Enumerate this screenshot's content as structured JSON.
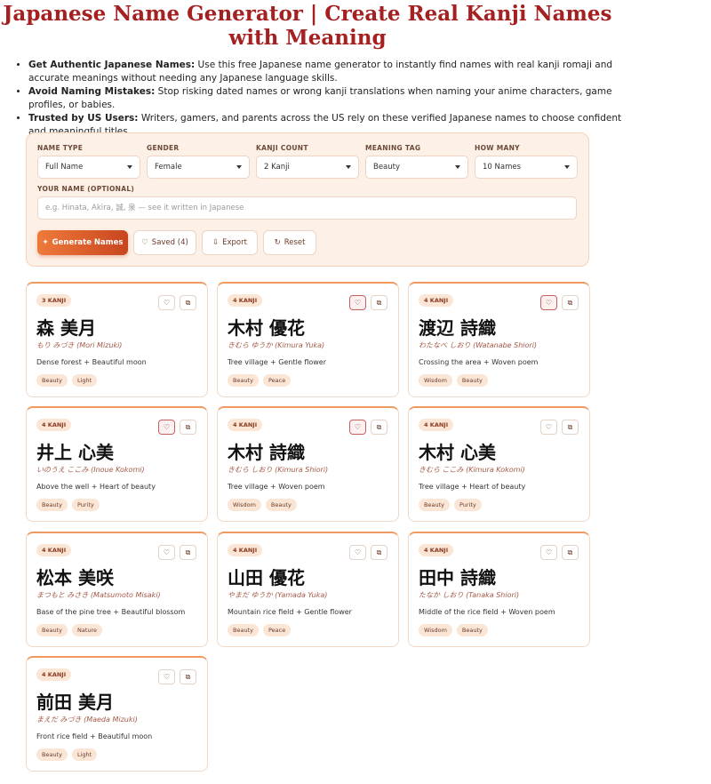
{
  "page": {
    "title": "Japanese Name Generator | Create Real Kanji Names with Meaning"
  },
  "bullets": [
    {
      "bold": "Get Authentic Japanese Names:",
      "text": " Use this free Japanese name generator to instantly find names with real kanji romaji and accurate meanings without needing any Japanese language skills."
    },
    {
      "bold": "Avoid Naming Mistakes:",
      "text": " Stop risking dated names or wrong kanji translations when naming your anime characters, game profiles, or babies."
    },
    {
      "bold": "Trusted by US Users:",
      "text": " Writers, gamers, and parents across the US rely on these verified Japanese names to choose confident and meaningful titles."
    }
  ],
  "form": {
    "name_type": {
      "label": "NAME TYPE",
      "value": "Full Name"
    },
    "gender": {
      "label": "GENDER",
      "value": "Female"
    },
    "kanji_count": {
      "label": "KANJI COUNT",
      "value": "2 Kanji"
    },
    "meaning_tag": {
      "label": "MEANING TAG",
      "value": "Beauty"
    },
    "how_many": {
      "label": "HOW MANY",
      "value": "10 Names"
    },
    "your_name": {
      "label": "YOUR NAME (OPTIONAL)",
      "placeholder": "e.g. Hinata, Akira, 誠, 泉 — see it written in Japanese"
    }
  },
  "actions": {
    "generate": "Generate Names",
    "saved": "Saved (4)",
    "export": "Export",
    "reset": "Reset"
  },
  "cards": [
    {
      "badge": "3 KANJI",
      "kanji": "森 美月",
      "reading": "もり みづき (Mori Mizuki)",
      "meaning": "Dense forest + Beautiful moon",
      "tags": [
        "Beauty",
        "Light"
      ],
      "saved": false
    },
    {
      "badge": "4 KANJI",
      "kanji": "木村 優花",
      "reading": "きむら ゆうか (Kimura Yuka)",
      "meaning": "Tree village + Gentle flower",
      "tags": [
        "Beauty",
        "Peace"
      ],
      "saved": true
    },
    {
      "badge": "4 KANJI",
      "kanji": "渡辺 詩織",
      "reading": "わたなべ しおり (Watanabe Shiori)",
      "meaning": "Crossing the area + Woven poem",
      "tags": [
        "Wisdom",
        "Beauty"
      ],
      "saved": true
    },
    {
      "badge": "4 KANJI",
      "kanji": "井上 心美",
      "reading": "いのうえ ここみ (Inoue Kokomi)",
      "meaning": "Above the well + Heart of beauty",
      "tags": [
        "Beauty",
        "Purity"
      ],
      "saved": true
    },
    {
      "badge": "4 KANJI",
      "kanji": "木村 詩織",
      "reading": "きむら しおり (Kimura Shiori)",
      "meaning": "Tree village + Woven poem",
      "tags": [
        "Wisdom",
        "Beauty"
      ],
      "saved": true
    },
    {
      "badge": "4 KANJI",
      "kanji": "木村 心美",
      "reading": "きむら ここみ (Kimura Kokomi)",
      "meaning": "Tree village + Heart of beauty",
      "tags": [
        "Beauty",
        "Purity"
      ],
      "saved": false
    },
    {
      "badge": "4 KANJI",
      "kanji": "松本 美咲",
      "reading": "まつもと みさき (Matsumoto Misaki)",
      "meaning": "Base of the pine tree + Beautiful blossom",
      "tags": [
        "Beauty",
        "Nature"
      ],
      "saved": false
    },
    {
      "badge": "4 KANJI",
      "kanji": "山田 優花",
      "reading": "やまだ ゆうか (Yamada Yuka)",
      "meaning": "Mountain rice field + Gentle flower",
      "tags": [
        "Beauty",
        "Peace"
      ],
      "saved": false
    },
    {
      "badge": "4 KANJI",
      "kanji": "田中 詩織",
      "reading": "たなか しおり (Tanaka Shiori)",
      "meaning": "Middle of the rice field + Woven poem",
      "tags": [
        "Wisdom",
        "Beauty"
      ],
      "saved": false
    },
    {
      "badge": "4 KANJI",
      "kanji": "前田 美月",
      "reading": "まえだ みづき (Maeda Mizuki)",
      "meaning": "Front rice field + Beautiful moon",
      "tags": [
        "Beauty",
        "Light"
      ],
      "saved": false
    }
  ],
  "icons": {
    "favorite": "heart-icon",
    "copy": "copy-icon",
    "sparkle": "sparkle-icon",
    "export": "download-icon",
    "reset": "refresh-icon"
  },
  "colors": {
    "title": "#a52020",
    "accent": "#e0662e",
    "panel_bg": "#fdf0e6"
  }
}
